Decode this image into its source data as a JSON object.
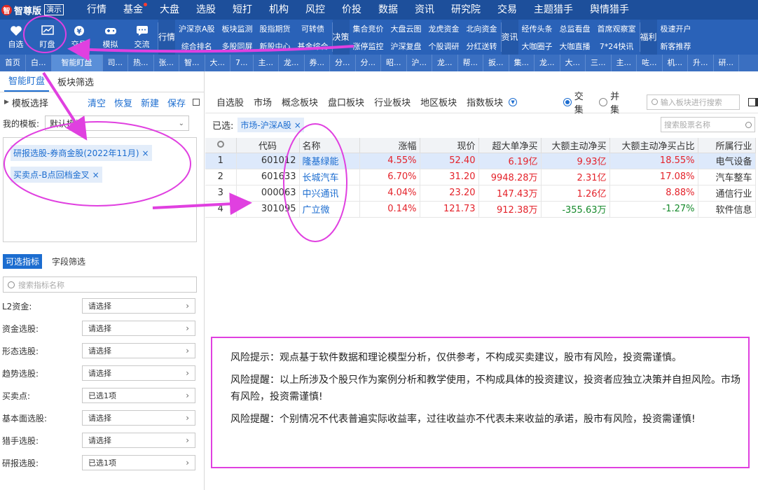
{
  "app": {
    "logo_mark": "智",
    "name": "智尊版",
    "badge": "演示"
  },
  "menu": [
    "行情",
    "基金",
    "大盘",
    "选股",
    "短打",
    "机构",
    "风控",
    "价投",
    "数据",
    "资讯",
    "研究院",
    "交易",
    "主题猎手",
    "舆情猎手"
  ],
  "toolbar": {
    "buttons": [
      "自选",
      "盯盘",
      "交易",
      "模拟",
      "交流"
    ],
    "groups": [
      {
        "tag": "行情",
        "items": [
          "沪深京A股",
          "综合排名",
          "板块监测",
          "多股同屏",
          "股指期货",
          "新股中心",
          "可转债",
          "基金综合"
        ]
      },
      {
        "tag": "决策",
        "items": [
          "集合竞价",
          "涨停监控",
          "大盘云图",
          "沪深复盘",
          "龙虎资金",
          "个股调研",
          "北向资金",
          "分红送转"
        ]
      },
      {
        "tag": "资讯",
        "items": [
          "经传头条",
          "大咖圈子",
          "总监看盘",
          "大咖直播",
          "首席观察室",
          "7*24快讯"
        ]
      },
      {
        "tag": "福利",
        "items": [
          "极速开户",
          "新客推荐"
        ]
      }
    ]
  },
  "tabs": [
    "首页",
    "白...",
    "智能盯盘",
    "司...",
    "热...",
    "张...",
    "智...",
    "大...",
    "7...",
    "主...",
    "龙...",
    "券...",
    "分...",
    "分...",
    "昭...",
    "沪...",
    "龙...",
    "帮...",
    "扳...",
    "集...",
    "龙...",
    "大...",
    "三...",
    "主...",
    "咗...",
    "机...",
    "升...",
    "研..."
  ],
  "left": {
    "tabs": [
      "智能盯盘",
      "板块筛选"
    ],
    "template_title": "模板选择",
    "actions": [
      "清空",
      "恢复",
      "新建",
      "保存"
    ],
    "my_template_label": "我的模板:",
    "my_template_value": "默认模板",
    "tags": [
      "研报选股-券商金股(2022年11月)",
      "买卖点-B点回档金叉"
    ],
    "section_tabs": [
      "可选指标",
      "字段筛选"
    ],
    "search_placeholder": "搜索指标名称",
    "filters": [
      {
        "label": "L2资金:",
        "value": "请选择"
      },
      {
        "label": "资金选股:",
        "value": "请选择"
      },
      {
        "label": "形态选股:",
        "value": "请选择"
      },
      {
        "label": "趋势选股:",
        "value": "请选择"
      },
      {
        "label": "买卖点:",
        "value": "已选1项"
      },
      {
        "label": "基本面选股:",
        "value": "请选择"
      },
      {
        "label": "猎手选股:",
        "value": "请选择"
      },
      {
        "label": "研报选股:",
        "value": "已选1项"
      }
    ]
  },
  "right": {
    "filter_tabs": [
      "自选股",
      "市场",
      "概念板块",
      "盘口板块",
      "行业板块",
      "地区板块",
      "指数板块"
    ],
    "radio": [
      "交集",
      "并集"
    ],
    "plate_search_placeholder": "输入板块进行搜索",
    "selected_label": "已选:",
    "selected_chip": "市场-沪深A股",
    "stock_search_placeholder": "搜索股票名称",
    "columns": [
      "代码",
      "名称",
      "涨幅",
      "现价",
      "超大单净买",
      "大额主动净买",
      "大额主动净买占比",
      "所属行业"
    ],
    "rows": [
      {
        "idx": "1",
        "code": "601012",
        "name": "隆基绿能",
        "chg": "4.55%",
        "price": "52.40",
        "big": "6.19亿",
        "net": "9.93亿",
        "ratio": "18.55%",
        "ind": "电气设备"
      },
      {
        "idx": "2",
        "code": "601633",
        "name": "长城汽车",
        "chg": "6.70%",
        "price": "31.20",
        "big": "9948.28万",
        "net": "2.31亿",
        "ratio": "17.08%",
        "ind": "汽车整车"
      },
      {
        "idx": "3",
        "code": "000063",
        "name": "中兴通讯",
        "chg": "4.04%",
        "price": "23.20",
        "big": "147.43万",
        "net": "1.26亿",
        "ratio": "8.88%",
        "ind": "通信行业"
      },
      {
        "idx": "4",
        "code": "301095",
        "name": "广立微",
        "chg": "0.14%",
        "price": "121.73",
        "big": "912.38万",
        "net": "-355.63万",
        "ratio": "-1.27%",
        "ind": "软件信息"
      }
    ]
  },
  "risk": [
    "风险提示：观点基于软件数据和理论模型分析，仅供参考，不构成买卖建议，股市有风险，投资需谨慎。",
    "风险提醒：以上所涉及个股只作为案例分析和教学使用，不构成具体的投资建议，投资者应独立决策并自担风险。市场有风险，投资需谨慎!",
    "风险提醒：个别情况不代表普遍实际收益率，过往收益亦不代表未来收益的承诺，股市有风险，投资需谨慎!"
  ],
  "colors": {
    "menubar": "#1d4f9b",
    "toolbar": "#2a62b8",
    "accent": "#1c6dd0",
    "up": "#e4222a",
    "down": "#168a2b",
    "annotation": "#e040e0"
  }
}
